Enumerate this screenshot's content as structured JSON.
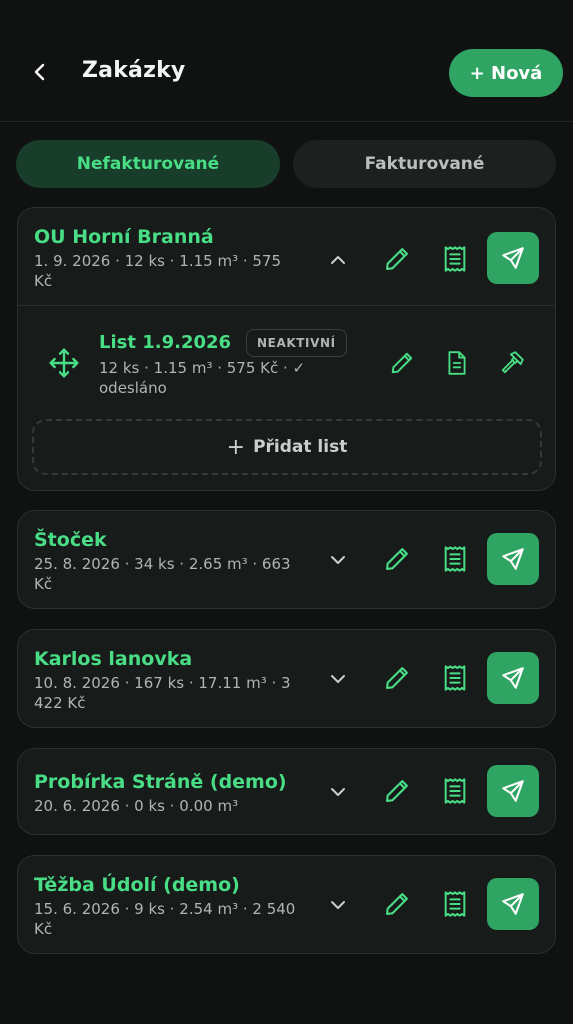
{
  "header": {
    "title": "Zakázky",
    "new_label": "+ Nová"
  },
  "tabs": [
    {
      "label": "Nefakturované",
      "active": true
    },
    {
      "label": "Fakturované",
      "active": false
    }
  ],
  "orders": [
    {
      "name": "OU Horní Branná",
      "meta": "1. 9. 2026 · 12 ks · 1.15 m³ · 575 Kč",
      "expanded": true,
      "sheets": [
        {
          "title": "List 1.9.2026",
          "badge": "NEAKTIVNÍ",
          "meta": "12 ks · 1.15 m³ · 575 Kč · ✓ odesláno"
        }
      ],
      "add_sheet_label": "Přidat list"
    },
    {
      "name": "Štoček",
      "meta": "25. 8. 2026 · 34 ks · 2.65 m³ · 663 Kč",
      "expanded": false
    },
    {
      "name": "Karlos lanovka",
      "meta": "10. 8. 2026 · 167 ks · 17.11 m³ · 3 422 Kč",
      "expanded": false
    },
    {
      "name": "Probírka Stráně (demo)",
      "meta": "20. 6. 2026 · 0 ks · 0.00 m³",
      "expanded": false
    },
    {
      "name": "Těžba Údolí (demo)",
      "meta": "15. 6. 2026 · 9 ks · 2.54 m³ · 2 540 Kč",
      "expanded": false
    }
  ],
  "icons": {
    "back": "chevron-left-icon",
    "expand": "chevron-down-icon",
    "collapse": "chevron-up-icon",
    "edit": "pencil-icon",
    "invoice": "receipt-icon",
    "send": "send-icon",
    "drag": "move-icon",
    "document": "document-icon",
    "hammer": "hammer-icon"
  },
  "colors": {
    "accent": "#49dd86",
    "button": "#2fa463",
    "background": "#0f1211",
    "card": "#171b19"
  }
}
